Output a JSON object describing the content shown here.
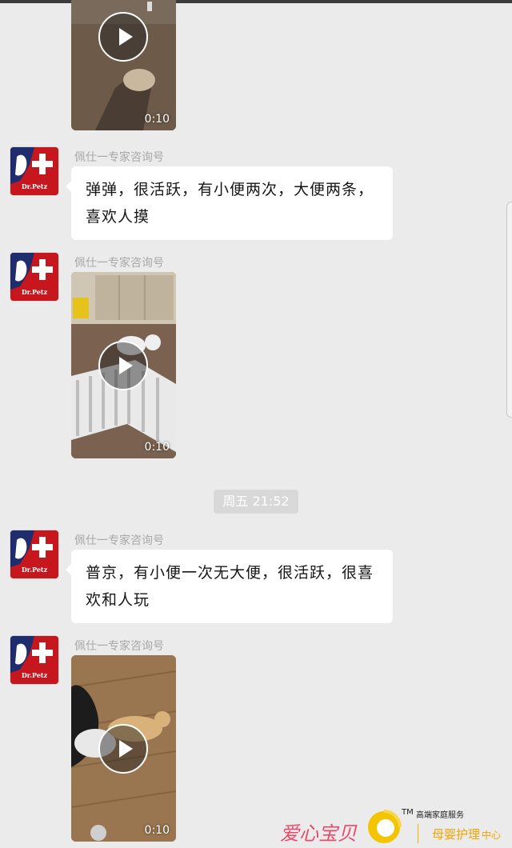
{
  "sender_name": "佩仕一专家咨询号",
  "avatar_label": "Dr.Petz",
  "messages": [
    {
      "type": "video",
      "duration": "0:10"
    },
    {
      "type": "text",
      "lines": [
        "弹弹，很活跃，有小便两次，大便两条，",
        "喜欢人摸"
      ]
    },
    {
      "type": "video",
      "duration": "0:10"
    },
    {
      "type": "time",
      "text": "周五 21:52"
    },
    {
      "type": "text",
      "lines": [
        "普京，有小便一次无大便，很活跃，很喜",
        "欢和人玩"
      ]
    },
    {
      "type": "video",
      "duration": "0:10"
    }
  ],
  "watermark": {
    "brand": "爱心宝贝",
    "tm": "TM",
    "service": "高端家庭服务",
    "center_main": "母婴护理",
    "center_suffix": "中心"
  },
  "colors": {
    "bubble": "#ffffff",
    "background": "#ebebeb",
    "avatar_red": "#c6161e",
    "sender": "#a8a8a8",
    "time_pill": "#d8d8d8"
  }
}
